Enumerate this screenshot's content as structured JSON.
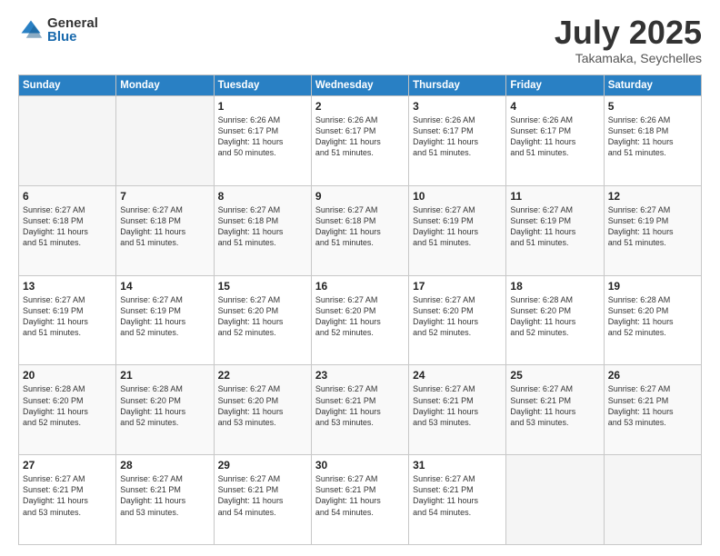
{
  "logo": {
    "general": "General",
    "blue": "Blue"
  },
  "title": "July 2025",
  "location": "Takamaka, Seychelles",
  "days_of_week": [
    "Sunday",
    "Monday",
    "Tuesday",
    "Wednesday",
    "Thursday",
    "Friday",
    "Saturday"
  ],
  "weeks": [
    [
      {
        "day": "",
        "sunrise": "",
        "sunset": "",
        "daylight": ""
      },
      {
        "day": "",
        "sunrise": "",
        "sunset": "",
        "daylight": ""
      },
      {
        "day": "1",
        "sunrise": "Sunrise: 6:26 AM",
        "sunset": "Sunset: 6:17 PM",
        "daylight": "Daylight: 11 hours and 50 minutes."
      },
      {
        "day": "2",
        "sunrise": "Sunrise: 6:26 AM",
        "sunset": "Sunset: 6:17 PM",
        "daylight": "Daylight: 11 hours and 51 minutes."
      },
      {
        "day": "3",
        "sunrise": "Sunrise: 6:26 AM",
        "sunset": "Sunset: 6:17 PM",
        "daylight": "Daylight: 11 hours and 51 minutes."
      },
      {
        "day": "4",
        "sunrise": "Sunrise: 6:26 AM",
        "sunset": "Sunset: 6:17 PM",
        "daylight": "Daylight: 11 hours and 51 minutes."
      },
      {
        "day": "5",
        "sunrise": "Sunrise: 6:26 AM",
        "sunset": "Sunset: 6:18 PM",
        "daylight": "Daylight: 11 hours and 51 minutes."
      }
    ],
    [
      {
        "day": "6",
        "sunrise": "Sunrise: 6:27 AM",
        "sunset": "Sunset: 6:18 PM",
        "daylight": "Daylight: 11 hours and 51 minutes."
      },
      {
        "day": "7",
        "sunrise": "Sunrise: 6:27 AM",
        "sunset": "Sunset: 6:18 PM",
        "daylight": "Daylight: 11 hours and 51 minutes."
      },
      {
        "day": "8",
        "sunrise": "Sunrise: 6:27 AM",
        "sunset": "Sunset: 6:18 PM",
        "daylight": "Daylight: 11 hours and 51 minutes."
      },
      {
        "day": "9",
        "sunrise": "Sunrise: 6:27 AM",
        "sunset": "Sunset: 6:18 PM",
        "daylight": "Daylight: 11 hours and 51 minutes."
      },
      {
        "day": "10",
        "sunrise": "Sunrise: 6:27 AM",
        "sunset": "Sunset: 6:19 PM",
        "daylight": "Daylight: 11 hours and 51 minutes."
      },
      {
        "day": "11",
        "sunrise": "Sunrise: 6:27 AM",
        "sunset": "Sunset: 6:19 PM",
        "daylight": "Daylight: 11 hours and 51 minutes."
      },
      {
        "day": "12",
        "sunrise": "Sunrise: 6:27 AM",
        "sunset": "Sunset: 6:19 PM",
        "daylight": "Daylight: 11 hours and 51 minutes."
      }
    ],
    [
      {
        "day": "13",
        "sunrise": "Sunrise: 6:27 AM",
        "sunset": "Sunset: 6:19 PM",
        "daylight": "Daylight: 11 hours and 51 minutes."
      },
      {
        "day": "14",
        "sunrise": "Sunrise: 6:27 AM",
        "sunset": "Sunset: 6:19 PM",
        "daylight": "Daylight: 11 hours and 52 minutes."
      },
      {
        "day": "15",
        "sunrise": "Sunrise: 6:27 AM",
        "sunset": "Sunset: 6:20 PM",
        "daylight": "Daylight: 11 hours and 52 minutes."
      },
      {
        "day": "16",
        "sunrise": "Sunrise: 6:27 AM",
        "sunset": "Sunset: 6:20 PM",
        "daylight": "Daylight: 11 hours and 52 minutes."
      },
      {
        "day": "17",
        "sunrise": "Sunrise: 6:27 AM",
        "sunset": "Sunset: 6:20 PM",
        "daylight": "Daylight: 11 hours and 52 minutes."
      },
      {
        "day": "18",
        "sunrise": "Sunrise: 6:28 AM",
        "sunset": "Sunset: 6:20 PM",
        "daylight": "Daylight: 11 hours and 52 minutes."
      },
      {
        "day": "19",
        "sunrise": "Sunrise: 6:28 AM",
        "sunset": "Sunset: 6:20 PM",
        "daylight": "Daylight: 11 hours and 52 minutes."
      }
    ],
    [
      {
        "day": "20",
        "sunrise": "Sunrise: 6:28 AM",
        "sunset": "Sunset: 6:20 PM",
        "daylight": "Daylight: 11 hours and 52 minutes."
      },
      {
        "day": "21",
        "sunrise": "Sunrise: 6:28 AM",
        "sunset": "Sunset: 6:20 PM",
        "daylight": "Daylight: 11 hours and 52 minutes."
      },
      {
        "day": "22",
        "sunrise": "Sunrise: 6:27 AM",
        "sunset": "Sunset: 6:20 PM",
        "daylight": "Daylight: 11 hours and 53 minutes."
      },
      {
        "day": "23",
        "sunrise": "Sunrise: 6:27 AM",
        "sunset": "Sunset: 6:21 PM",
        "daylight": "Daylight: 11 hours and 53 minutes."
      },
      {
        "day": "24",
        "sunrise": "Sunrise: 6:27 AM",
        "sunset": "Sunset: 6:21 PM",
        "daylight": "Daylight: 11 hours and 53 minutes."
      },
      {
        "day": "25",
        "sunrise": "Sunrise: 6:27 AM",
        "sunset": "Sunset: 6:21 PM",
        "daylight": "Daylight: 11 hours and 53 minutes."
      },
      {
        "day": "26",
        "sunrise": "Sunrise: 6:27 AM",
        "sunset": "Sunset: 6:21 PM",
        "daylight": "Daylight: 11 hours and 53 minutes."
      }
    ],
    [
      {
        "day": "27",
        "sunrise": "Sunrise: 6:27 AM",
        "sunset": "Sunset: 6:21 PM",
        "daylight": "Daylight: 11 hours and 53 minutes."
      },
      {
        "day": "28",
        "sunrise": "Sunrise: 6:27 AM",
        "sunset": "Sunset: 6:21 PM",
        "daylight": "Daylight: 11 hours and 53 minutes."
      },
      {
        "day": "29",
        "sunrise": "Sunrise: 6:27 AM",
        "sunset": "Sunset: 6:21 PM",
        "daylight": "Daylight: 11 hours and 54 minutes."
      },
      {
        "day": "30",
        "sunrise": "Sunrise: 6:27 AM",
        "sunset": "Sunset: 6:21 PM",
        "daylight": "Daylight: 11 hours and 54 minutes."
      },
      {
        "day": "31",
        "sunrise": "Sunrise: 6:27 AM",
        "sunset": "Sunset: 6:21 PM",
        "daylight": "Daylight: 11 hours and 54 minutes."
      },
      {
        "day": "",
        "sunrise": "",
        "sunset": "",
        "daylight": ""
      },
      {
        "day": "",
        "sunrise": "",
        "sunset": "",
        "daylight": ""
      }
    ]
  ]
}
